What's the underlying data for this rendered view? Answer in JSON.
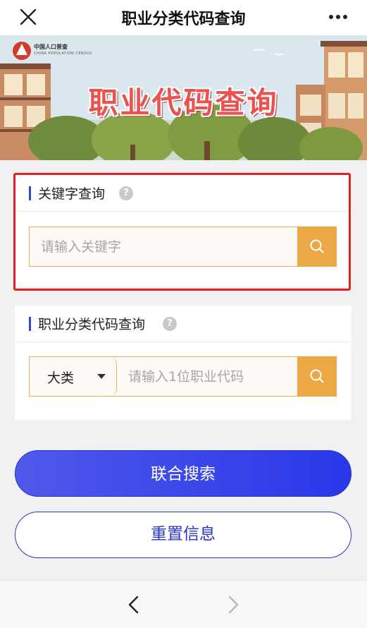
{
  "header": {
    "title": "职业分类代码查询",
    "close_icon": "close-icon",
    "more_icon": "more-dots-icon"
  },
  "banner": {
    "logo_title": "中国人口普查",
    "logo_subtitle": "CHINA POPULATION CENSUS",
    "headline": "职业代码查询"
  },
  "keyword_section": {
    "title": "关键字查询",
    "help_label": "?",
    "input_placeholder": "请输入关键字",
    "input_value": ""
  },
  "code_section": {
    "title": "职业分类代码查询",
    "help_label": "?",
    "category_selected": "大类",
    "input_placeholder": "请输入1位职业代码",
    "input_value": ""
  },
  "actions": {
    "search_label": "联合搜索",
    "reset_label": "重置信息"
  },
  "colors": {
    "accent_orange": "#eca845",
    "primary_blue": "#2a37ea",
    "highlight_red": "#e2201f",
    "banner_headline": "#e8524f"
  }
}
